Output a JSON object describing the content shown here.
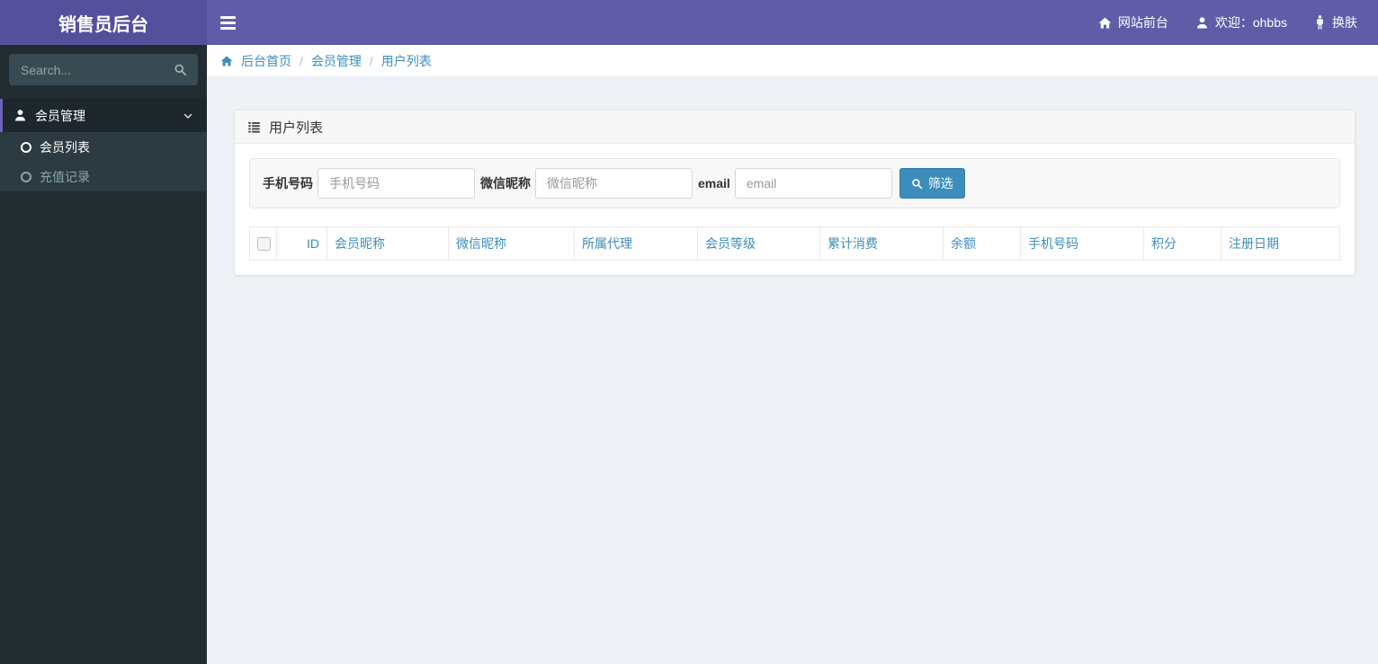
{
  "colors": {
    "navbar": "#605ca8",
    "logo_bg": "#54509c",
    "accent_link": "#3c8dbc",
    "filter_button": "#3c8dbc",
    "sidebar_bg": "#222d32",
    "submenu_bg": "#2c3b41",
    "active_item_bg": "#1e282c",
    "active_item_border": "#6f62c1",
    "content_bg": "#eef1f6"
  },
  "header": {
    "logo_title": "销售员后台",
    "frontend_label": "网站前台",
    "welcome_label": "欢迎：ohbbs",
    "skin_label": "换肤"
  },
  "sidebar": {
    "search_placeholder": "Search...",
    "menu": {
      "label": "会员管理",
      "items": [
        {
          "label": "会员列表",
          "active": true
        },
        {
          "label": "充值记录",
          "active": false
        }
      ]
    }
  },
  "breadcrumb": {
    "separator": "/",
    "items": [
      "后台首页",
      "会员管理",
      "用户列表"
    ]
  },
  "panel": {
    "title": "用户列表",
    "filters": [
      {
        "label": "手机号码",
        "placeholder": "手机号码"
      },
      {
        "label": "微信昵称",
        "placeholder": "微信昵称"
      },
      {
        "label": "email",
        "placeholder": "email"
      }
    ],
    "filter_button_label": "筛选",
    "table": {
      "columns": [
        "ID",
        "会员昵称",
        "微信昵称",
        "所属代理",
        "会员等级",
        "累计消费",
        "余额",
        "手机号码",
        "积分",
        "注册日期"
      ],
      "rows": []
    }
  },
  "icons": {
    "hamburger": "☰",
    "home": "⌂",
    "user": "bust",
    "person": "standing-figure",
    "search": "magnifier",
    "list": "list-lines",
    "chevron_down": "v",
    "circle_o": "○"
  }
}
